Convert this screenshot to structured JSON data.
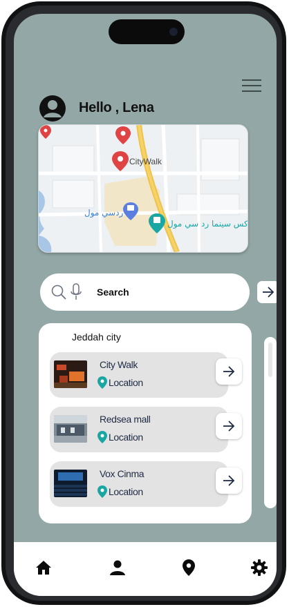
{
  "header": {
    "greeting": "Hello , Lena"
  },
  "map": {
    "labels": {
      "citywalk": "CityWalk",
      "redsea": "ردسي مول",
      "cinema": "كس سينما رد سي مول"
    }
  },
  "search": {
    "placeholder": "Search"
  },
  "list": {
    "city": "Jeddah city",
    "items": [
      {
        "title": "City Walk",
        "location_label": "Location"
      },
      {
        "title": "Redsea mall",
        "location_label": "Location"
      },
      {
        "title": "Vox Cinma",
        "location_label": "Location"
      }
    ]
  },
  "nav": {
    "icons": [
      "home-icon",
      "person-icon",
      "location-pin-icon",
      "gear-icon"
    ]
  },
  "colors": {
    "screen_bg": "#93a8a6",
    "teal_pin": "#1aa6a3",
    "text_dark": "#1e2a44"
  }
}
